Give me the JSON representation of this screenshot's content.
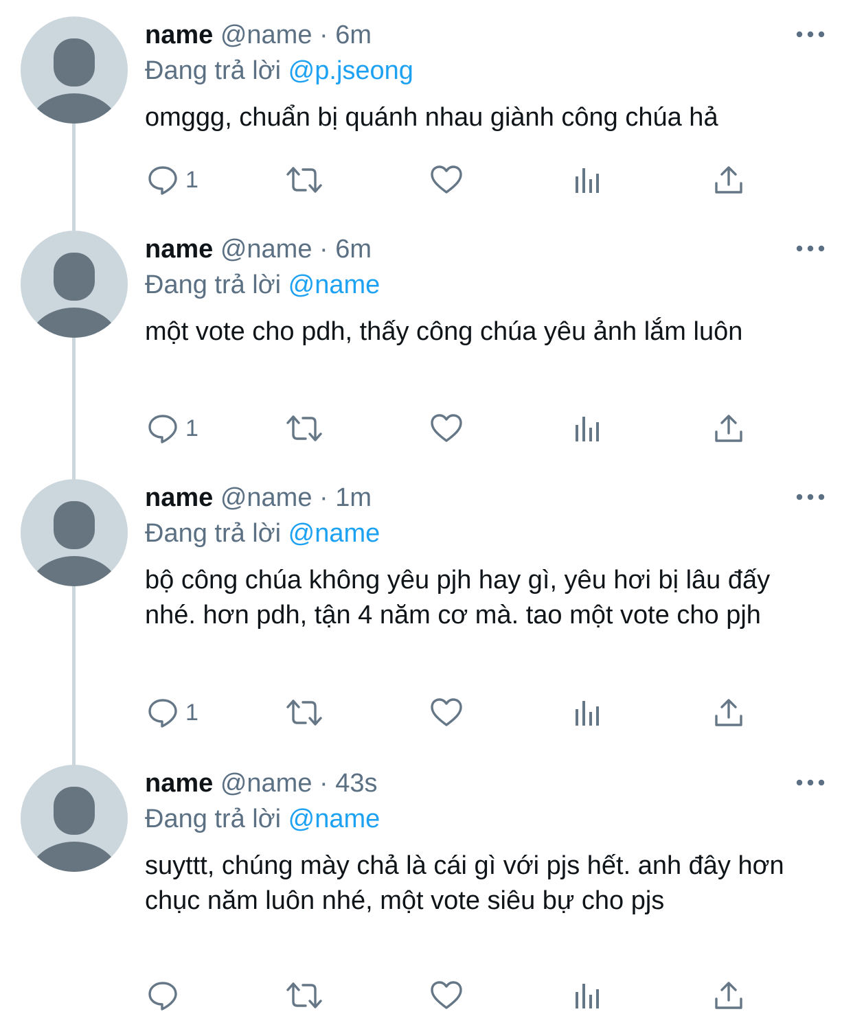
{
  "tweets": [
    {
      "name": "name",
      "handle": "@name",
      "separator": "·",
      "time": "6m",
      "reply_prefix": "Đang trả lời",
      "reply_to": "@p.jseong",
      "text": "omggg, chuẩn bị quánh nhau giành công chúa hả",
      "reply_count": "1"
    },
    {
      "name": "name",
      "handle": "@name",
      "separator": "·",
      "time": "6m",
      "reply_prefix": "Đang trả lời",
      "reply_to": "@name",
      "text": "một vote cho pdh, thấy công chúa yêu ảnh lắm luôn",
      "reply_count": "1"
    },
    {
      "name": "name",
      "handle": "@name",
      "separator": "·",
      "time": "1m",
      "reply_prefix": "Đang trả lời",
      "reply_to": "@name",
      "text": "bộ công chúa không yêu pjh hay gì, yêu hơi bị lâu đấy nhé. hơn pdh, tận 4 năm cơ mà. tao một vote cho pjh",
      "reply_count": "1"
    },
    {
      "name": "name",
      "handle": "@name",
      "separator": "·",
      "time": "43s",
      "reply_prefix": "Đang trả lời",
      "reply_to": "@name",
      "text": "suyttt, chúng mày chả là cái gì với pjs hết. anh đây hơn chục năm luôn nhé, một vote siêu bự cho pjs",
      "reply_count": ""
    }
  ],
  "icons": {
    "reply": "reply-icon",
    "retweet": "retweet-icon",
    "like": "heart-icon",
    "analytics": "analytics-icon",
    "share": "share-icon",
    "more": "more-icon"
  },
  "colors": {
    "mention": "#1da1f2",
    "secondary_text": "#5b7083",
    "avatar_bg": "#ccd6dd",
    "avatar_fg": "#66757f",
    "icon": "#657786"
  }
}
